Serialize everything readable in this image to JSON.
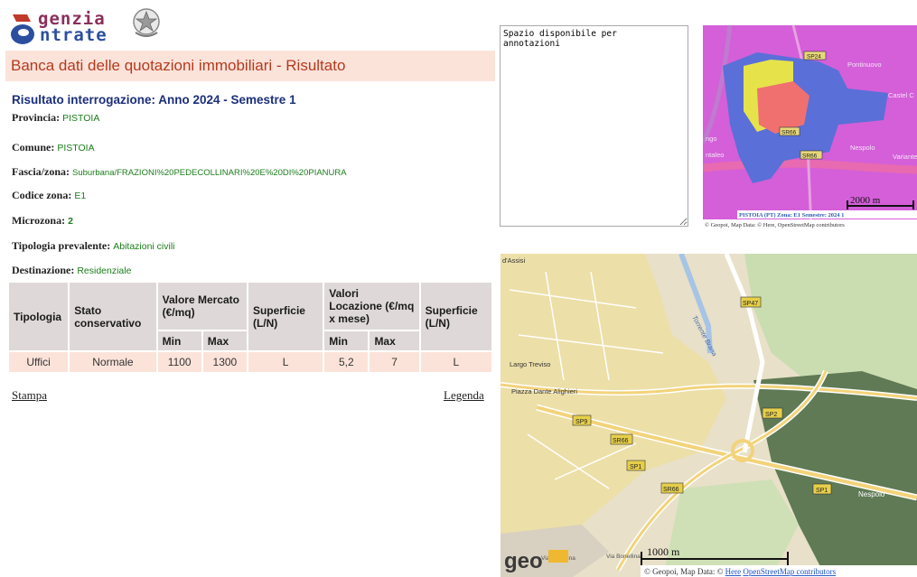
{
  "logo": {
    "word1": "genzia",
    "word2": "ntrate"
  },
  "header": {
    "title": "Banca dati delle quotazioni immobiliari - Risultato"
  },
  "result": {
    "heading": "Risultato interrogazione: Anno 2024 - Semestre 1",
    "fields": [
      {
        "label": "Provincia:",
        "value": "PISTOIA"
      },
      {
        "label": "Comune:",
        "value": "PISTOIA"
      },
      {
        "label": "Fascia/zona:",
        "value": "Suburbana/FRAZIONI%20PEDECOLLINARI%20E%20DI%20PIANURA"
      },
      {
        "label": "Codice zona:",
        "value": "E1"
      },
      {
        "label": "Microzona:",
        "value": "2"
      },
      {
        "label": "Tipologia prevalente:",
        "value": "Abitazioni civili"
      },
      {
        "label": "Destinazione:",
        "value": "Residenziale"
      }
    ]
  },
  "table": {
    "headers": {
      "tipologia": "Tipologia",
      "stato": "Stato conservativo",
      "valore_mercato": "Valore Mercato (€/mq)",
      "superficie1": "Superficie (L/N)",
      "valori_locazione": "Valori Locazione (€/mq x mese)",
      "superficie2": "Superficie (L/N)",
      "min1": "Min",
      "max1": "Max",
      "min2": "Min",
      "max2": "Max"
    },
    "rows": [
      {
        "tipologia": "Uffici",
        "stato": "Normale",
        "vm_min": "1100",
        "vm_max": "1300",
        "sup1": "L",
        "vl_min": "5,2",
        "vl_max": "7",
        "sup2": "L"
      }
    ]
  },
  "links": {
    "stampa": "Stampa",
    "legenda": "Legenda"
  },
  "notes": {
    "text": "Spazio disponibile per\nannotazioni"
  },
  "map_small": {
    "places": [
      "Pontinuovo",
      "Castel C",
      "Nespolo",
      "Variante P",
      "ntaleo",
      "ngo"
    ],
    "roads": [
      "SP24",
      "SR66",
      "SR66"
    ],
    "scale": "2000 m",
    "zone_label": "PISTOIA (PT) Zona: E1 Semestre: 2024 1",
    "attribution": "© Geopoi, Map Data: © Here, OpenStreetMap contributors"
  },
  "map_big": {
    "places": [
      "d'Assisi",
      "Torrente Brana",
      "Largo Treviso",
      "Piazza Dante Alighieri",
      "Nespolo",
      "Via Bonellina",
      "Via Bonellina"
    ],
    "roads": [
      "SP47",
      "SP2",
      "SP9",
      "SR66",
      "SP1",
      "SR66",
      "SP1"
    ],
    "scale": "1000 m",
    "brand": "geo",
    "attribution_prefix": "© Geopoi, Map Data: © ",
    "attribution_link1": "Here",
    "attribution_link2": "OpenStreetMap contributors"
  },
  "colors": {
    "header_band": "#fbe3da",
    "header_title": "#b53a1e",
    "heading_blue": "#1b2f7c",
    "value_green": "#1b7d1b",
    "table_header": "#ded9d8",
    "table_row": "#fbe3da"
  }
}
